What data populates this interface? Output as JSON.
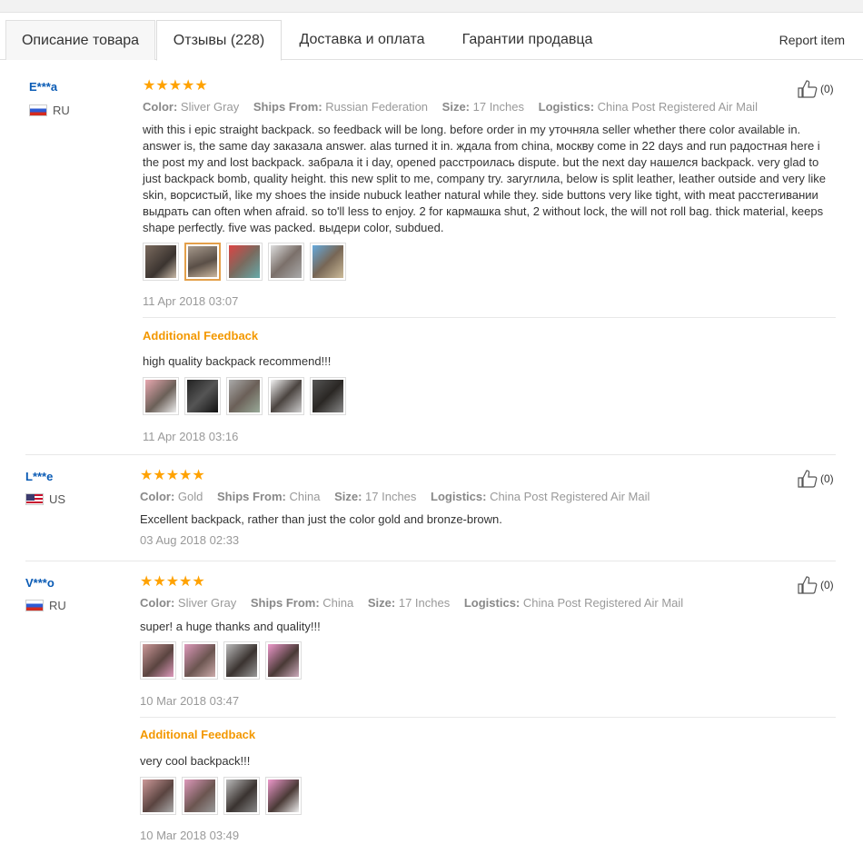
{
  "tabs": [
    {
      "label": "Описание товара"
    },
    {
      "label": "Отзывы (228)"
    },
    {
      "label": "Доставка и оплата"
    },
    {
      "label": "Гарантии продавца"
    }
  ],
  "report_label": "Report item",
  "labels": {
    "color": "Color:",
    "ships_from": "Ships From:",
    "size": "Size:",
    "logistics": "Logistics:",
    "additional": "Additional Feedback"
  },
  "reviews": [
    {
      "user": "E***a",
      "country": "RU",
      "stars": "★★★★★",
      "likes": "(0)",
      "color": "Sliver Gray",
      "ships_from": "Russian Federation",
      "size": "17 Inches",
      "logistics": "China Post Registered Air Mail",
      "text": "with this i epic straight backpack. so feedback will be long. before order in my уточняла seller whether there color available in. answer is, the same day заказала answer. alas turned it in. ждала from china, москву come in 22 days and run радостная here i the post my and lost backpack. забрала it i day, opened расстроилась dispute. but the next day нашелся backpack. very glad to just backpack bomb, quality height. this new split to me, company try. загуглила, below is split leather, leather outside and very like skin, ворсистый, like my shoes the inside nubuck leather natural while they. side buttons very like tight, with meat расстегивании выдрать can often when afraid. so to'll less to enjoy. 2 for кармашка shut, 2 without lock, the will not roll bag. thick material, keeps shape perfectly. five was packed. выдери color, subdued.",
      "date": "11 Apr 2018 03:07",
      "additional_text": "high quality backpack recommend!!!",
      "additional_date": "11 Apr 2018 03:16"
    },
    {
      "user": "L***e",
      "country": "US",
      "stars": "★★★★★",
      "likes": "(0)",
      "color": "Gold",
      "ships_from": "China",
      "size": "17 Inches",
      "logistics": "China Post Registered Air Mail",
      "text": "Excellent backpack, rather than just the color gold and bronze-brown.",
      "date": "03 Aug 2018 02:33"
    },
    {
      "user": "V***o",
      "country": "RU",
      "stars": "★★★★★",
      "likes": "(0)",
      "color": "Sliver Gray",
      "ships_from": "China",
      "size": "17 Inches",
      "logistics": "China Post Registered Air Mail",
      "text": "super! a huge thanks and quality!!!",
      "date": "10 Mar 2018 03:47",
      "additional_text": "very cool backpack!!!",
      "additional_date": "10 Mar 2018 03:49"
    }
  ]
}
